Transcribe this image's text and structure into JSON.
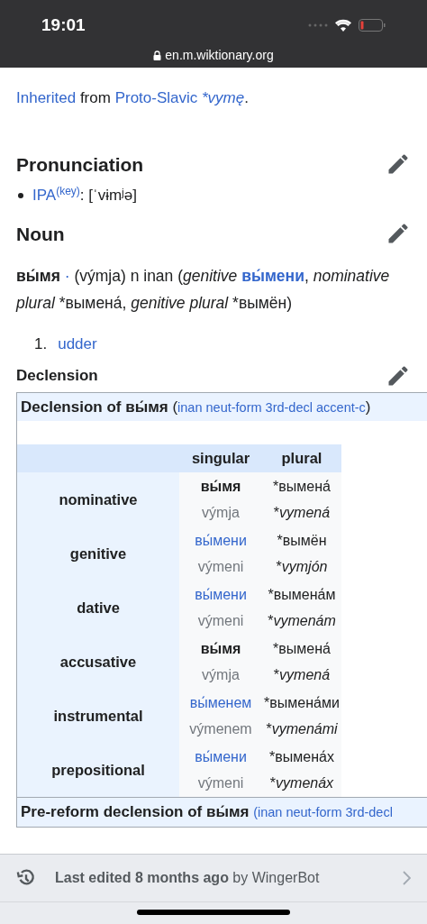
{
  "status_bar": {
    "time": "19:01"
  },
  "address_bar": {
    "url": "en.m.wiktionary.org"
  },
  "etymology": [
    {
      "text": "Inherited",
      "kind": "link"
    },
    {
      "text": " from ",
      "kind": "plain"
    },
    {
      "text": "Proto-Slavic ",
      "kind": "link"
    },
    {
      "text": "*vymę",
      "kind": "italic-link"
    },
    {
      "text": ".",
      "kind": "plain"
    }
  ],
  "pronunciation": {
    "heading": "Pronunciation",
    "ipa_label": "IPA",
    "key_label": "(key)",
    "ipa": ": [ˈvɨmʲə]"
  },
  "noun": {
    "heading": "Noun",
    "headword": [
      {
        "text": "вы́мя",
        "kind": "bold"
      },
      {
        "text": " · ",
        "kind": "dot"
      },
      {
        "text": "(výmja) n inan (",
        "kind": "plain"
      },
      {
        "text": "genitive ",
        "kind": "italic"
      },
      {
        "text": "вы́мени",
        "kind": "bold-link"
      },
      {
        "text": ", ",
        "kind": "plain"
      },
      {
        "text": "nominative plural",
        "kind": "italic"
      },
      {
        "text": " *вымена́, ",
        "kind": "plain"
      },
      {
        "text": "genitive plural",
        "kind": "italic"
      },
      {
        "text": " *вымён)",
        "kind": "plain"
      }
    ],
    "senses": [
      {
        "number": "1.",
        "text": "udder"
      }
    ]
  },
  "declension": {
    "heading": "Declension",
    "title": "Declension of вы́мя",
    "title_tag": "inan neut-form 3rd-decl accent-c",
    "paren_open": "(",
    "paren_close": ")",
    "columns": [
      "singular",
      "plural"
    ],
    "rows": [
      {
        "case": "nominative",
        "singular": {
          "form": "вы́мя",
          "kind": "self",
          "translit": "výmja"
        },
        "plural": {
          "mark": "*",
          "form": "вымена́",
          "translit": "vymená"
        }
      },
      {
        "case": "genitive",
        "singular": {
          "form": "вы́мени",
          "kind": "link",
          "translit": "výmeni"
        },
        "plural": {
          "mark": "*",
          "form": "вымён",
          "translit": "vymjón"
        }
      },
      {
        "case": "dative",
        "singular": {
          "form": "вы́мени",
          "kind": "link",
          "translit": "výmeni"
        },
        "plural": {
          "mark": "*",
          "form": "вымена́м",
          "translit": "vymenám"
        }
      },
      {
        "case": "accusative",
        "singular": {
          "form": "вы́мя",
          "kind": "self",
          "translit": "výmja"
        },
        "plural": {
          "mark": "*",
          "form": "вымена́",
          "translit": "vymená"
        }
      },
      {
        "case": "instrumental",
        "singular": {
          "form": "вы́менем",
          "kind": "link",
          "translit": "výmenem"
        },
        "plural": {
          "mark": "*",
          "form": "вымена́ми",
          "translit": "vymenámi"
        }
      },
      {
        "case": "prepositional",
        "singular": {
          "form": "вы́мени",
          "kind": "link",
          "translit": "výmeni"
        },
        "plural": {
          "mark": "*",
          "form": "вымена́х",
          "translit": "vymenáx"
        }
      }
    ],
    "pre_reform_title": "Pre-reform declension of вы́мя",
    "pre_reform_tag": "(inan neut-form 3rd-decl"
  },
  "footer": {
    "edited": "Last edited 8 months ago",
    "by": " by WingerBot"
  }
}
